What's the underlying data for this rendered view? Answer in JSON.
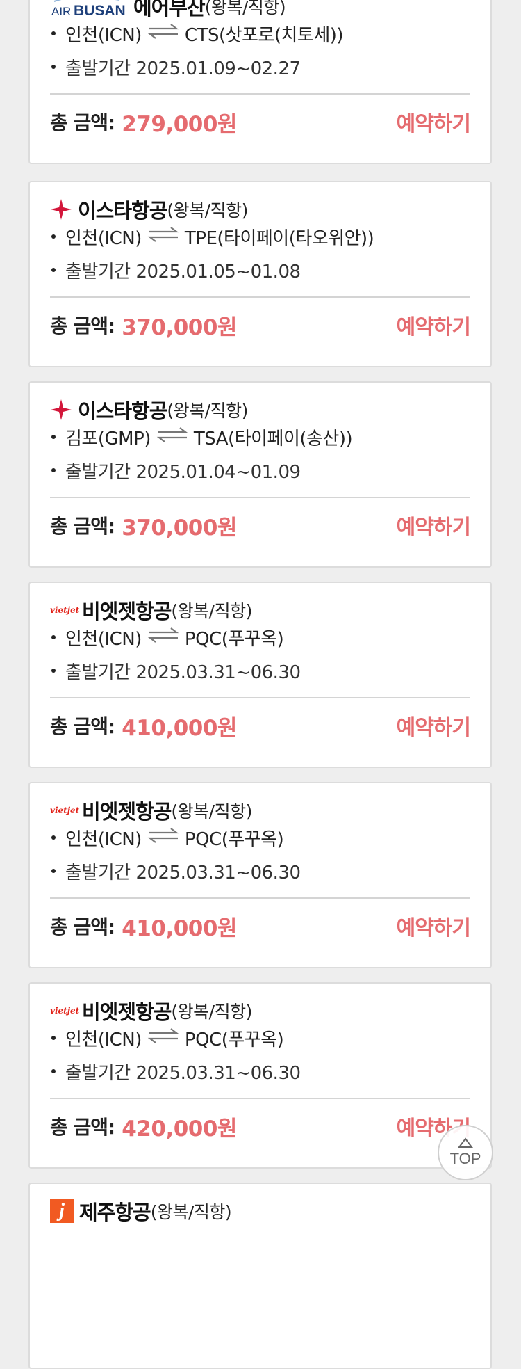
{
  "labels": {
    "total_label": "총 금액:",
    "book_label": "예약하기",
    "top_label": "TOP"
  },
  "colors": {
    "price": "#e56b6f",
    "card_border": "#dcdcdc",
    "background": "#eeeeee"
  },
  "cards": [
    {
      "logo_icon": "air-busan-logo-icon",
      "logo_text_small": "AIR",
      "logo_text_big": "BUSAN",
      "airline": "에어부산",
      "trip": "(왕복/직항)",
      "origin": "인천(ICN)",
      "destination": "CTS(삿포로(치토세))",
      "period": "출발기간 2025.01.09~02.27",
      "price": "279,000원"
    },
    {
      "logo_icon": "eastar-star-icon",
      "airline": "이스타항공",
      "trip": "(왕복/직항)",
      "origin": "인천(ICN)",
      "destination": "TPE(타이페이(타오위안))",
      "period": "출발기간 2025.01.05~01.08",
      "price": "370,000원"
    },
    {
      "logo_icon": "eastar-star-icon",
      "airline": "이스타항공",
      "trip": "(왕복/직항)",
      "origin": "김포(GMP)",
      "destination": "TSA(타이페이(송산))",
      "period": "출발기간 2025.01.04~01.09",
      "price": "370,000원"
    },
    {
      "logo_icon": "vietjet-logo-icon",
      "logo_text": "vietjet",
      "airline": "비엣젯항공",
      "trip": "(왕복/직항)",
      "origin": "인천(ICN)",
      "destination": "PQC(푸꾸옥)",
      "period": "출발기간 2025.03.31~06.30",
      "price": "410,000원"
    },
    {
      "logo_icon": "vietjet-logo-icon",
      "logo_text": "vietjet",
      "airline": "비엣젯항공",
      "trip": "(왕복/직항)",
      "origin": "인천(ICN)",
      "destination": "PQC(푸꾸옥)",
      "period": "출발기간 2025.03.31~06.30",
      "price": "410,000원"
    },
    {
      "logo_icon": "vietjet-logo-icon",
      "logo_text": "vietjet",
      "airline": "비엣젯항공",
      "trip": "(왕복/직항)",
      "origin": "인천(ICN)",
      "destination": "PQC(푸꾸옥)",
      "period": "출발기간 2025.03.31~06.30",
      "price": "420,000원"
    },
    {
      "logo_icon": "jeju-air-logo-icon",
      "logo_text": "j",
      "airline": "제주항공",
      "trip": "(왕복/직항)"
    }
  ]
}
